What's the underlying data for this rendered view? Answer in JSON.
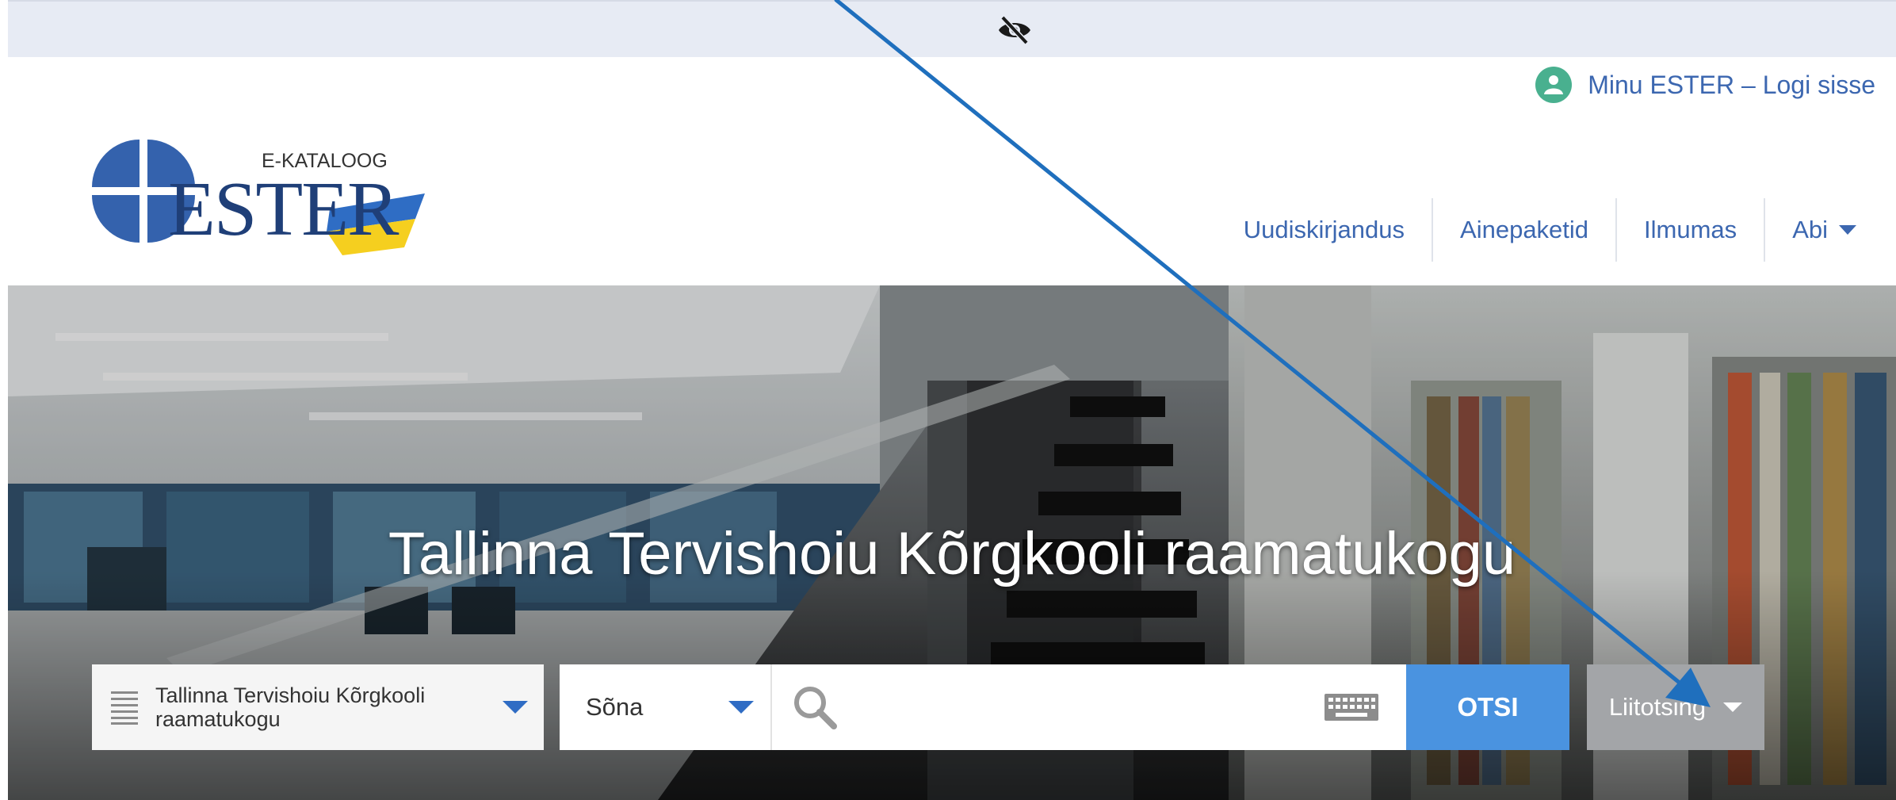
{
  "header": {
    "login_label": "Minu ESTER – Logi sisse",
    "logo_caption": "E-KATALOOG",
    "logo_word": "ESTER"
  },
  "nav": {
    "items": [
      {
        "label": "Uudiskirjandus"
      },
      {
        "label": "Ainepaketid"
      },
      {
        "label": "Ilmumas"
      },
      {
        "label": "Abi"
      }
    ]
  },
  "hero": {
    "title": "Tallinna Tervishoiu Kõrgkooli raamatukogu"
  },
  "search": {
    "library_value": "Tallinna Tervishoiu Kõrgkooli raamatukogu",
    "field_value": "Sõna",
    "query_value": "",
    "submit_label": "OTSI",
    "advanced_label": "Liitotsing"
  },
  "icons": {
    "a11y": "eye-slash-icon",
    "user": "user-icon",
    "search": "search-icon",
    "keyboard": "keyboard-icon",
    "library_list": "list-icon"
  },
  "colors": {
    "link": "#3c67b0",
    "accent": "#4a93e0",
    "caret": "#2f6cc4",
    "advanced_bg": "#a3a5a8",
    "user_icon": "#49b08f",
    "annotation_arrow": "#1f6fbd",
    "a11y_bar": "#e7ebf4"
  }
}
